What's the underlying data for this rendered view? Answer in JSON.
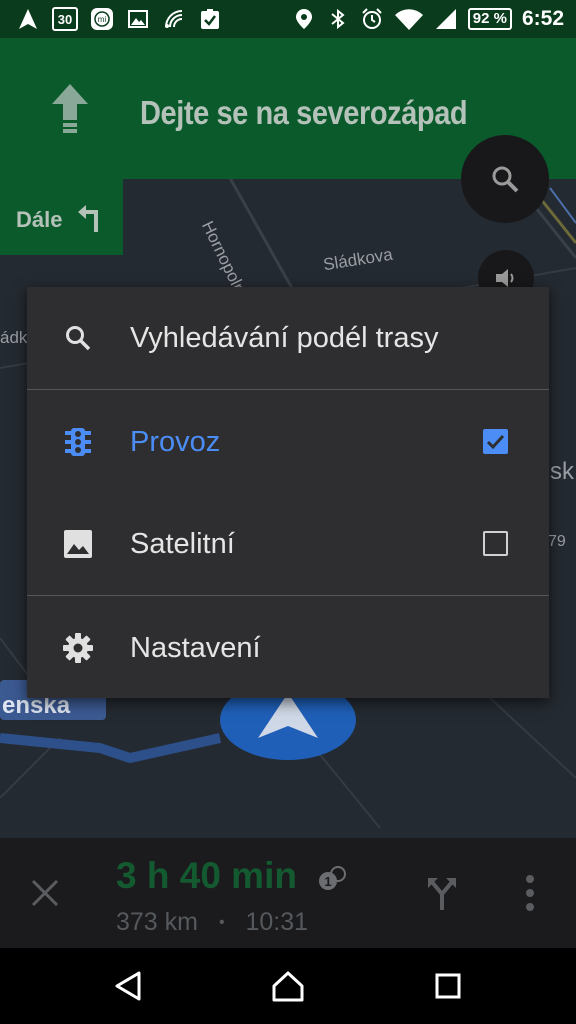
{
  "status_bar": {
    "date_badge": "30",
    "battery_percent": "92 %",
    "time": "6:52",
    "left_icons": [
      "navigation-icon",
      "calendar-icon",
      "mi-icon",
      "image-icon",
      "signal-stream-icon",
      "clipboard-check-icon"
    ],
    "right_icons": [
      "location-icon",
      "bluetooth-icon",
      "alarm-icon",
      "wifi-icon",
      "cellular-icon",
      "battery-icon"
    ]
  },
  "navigation": {
    "instruction": "Dejte se na severozápad",
    "then_label": "Dále"
  },
  "map": {
    "street_1": "Hornopolní",
    "street_2": "Sládkova",
    "street_3": "ádk",
    "street_4": "sk",
    "street_5": "enska",
    "street_6": "79"
  },
  "menu": {
    "search_along_route": "Vyhledávání podél trasy",
    "traffic": "Provoz",
    "traffic_checked": true,
    "satellite": "Satelitní",
    "satellite_checked": false,
    "settings": "Nastavení"
  },
  "trip": {
    "eta_duration": "3 h 40 min",
    "distance": "373 km",
    "separator": "•",
    "arrival_time": "10:31"
  },
  "colors": {
    "accent_blue": "#4c8df5",
    "nav_green": "#0a5a2c",
    "eta_green": "#145a30"
  }
}
